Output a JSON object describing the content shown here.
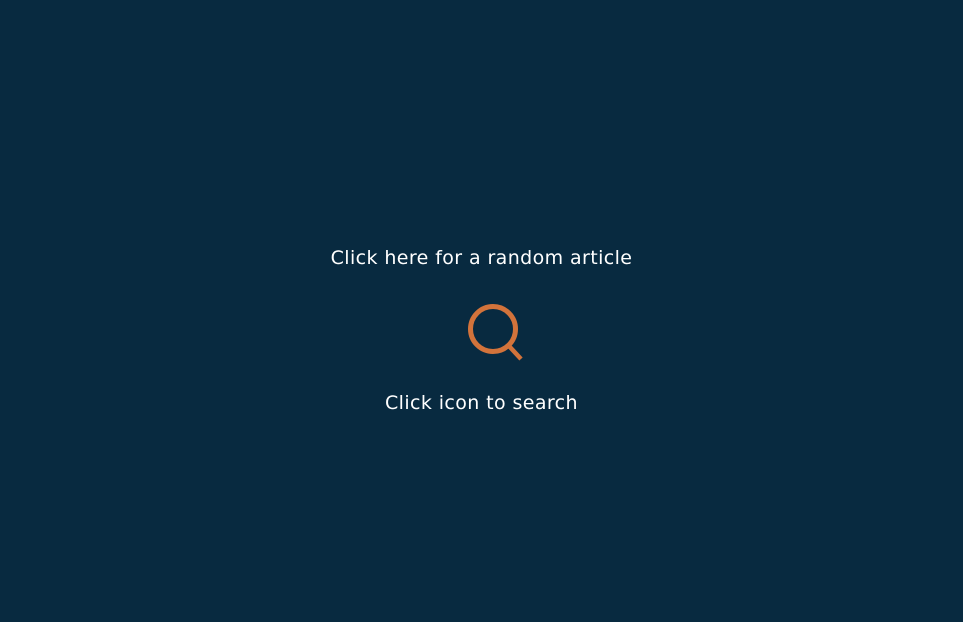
{
  "page": {
    "background_color": "#082a40",
    "text_color": "#ffffff",
    "accent_color": "#d2733b"
  },
  "random_article": {
    "label": "Click here for a random article"
  },
  "search": {
    "icon": "search-icon",
    "hint": "Click icon to search"
  }
}
